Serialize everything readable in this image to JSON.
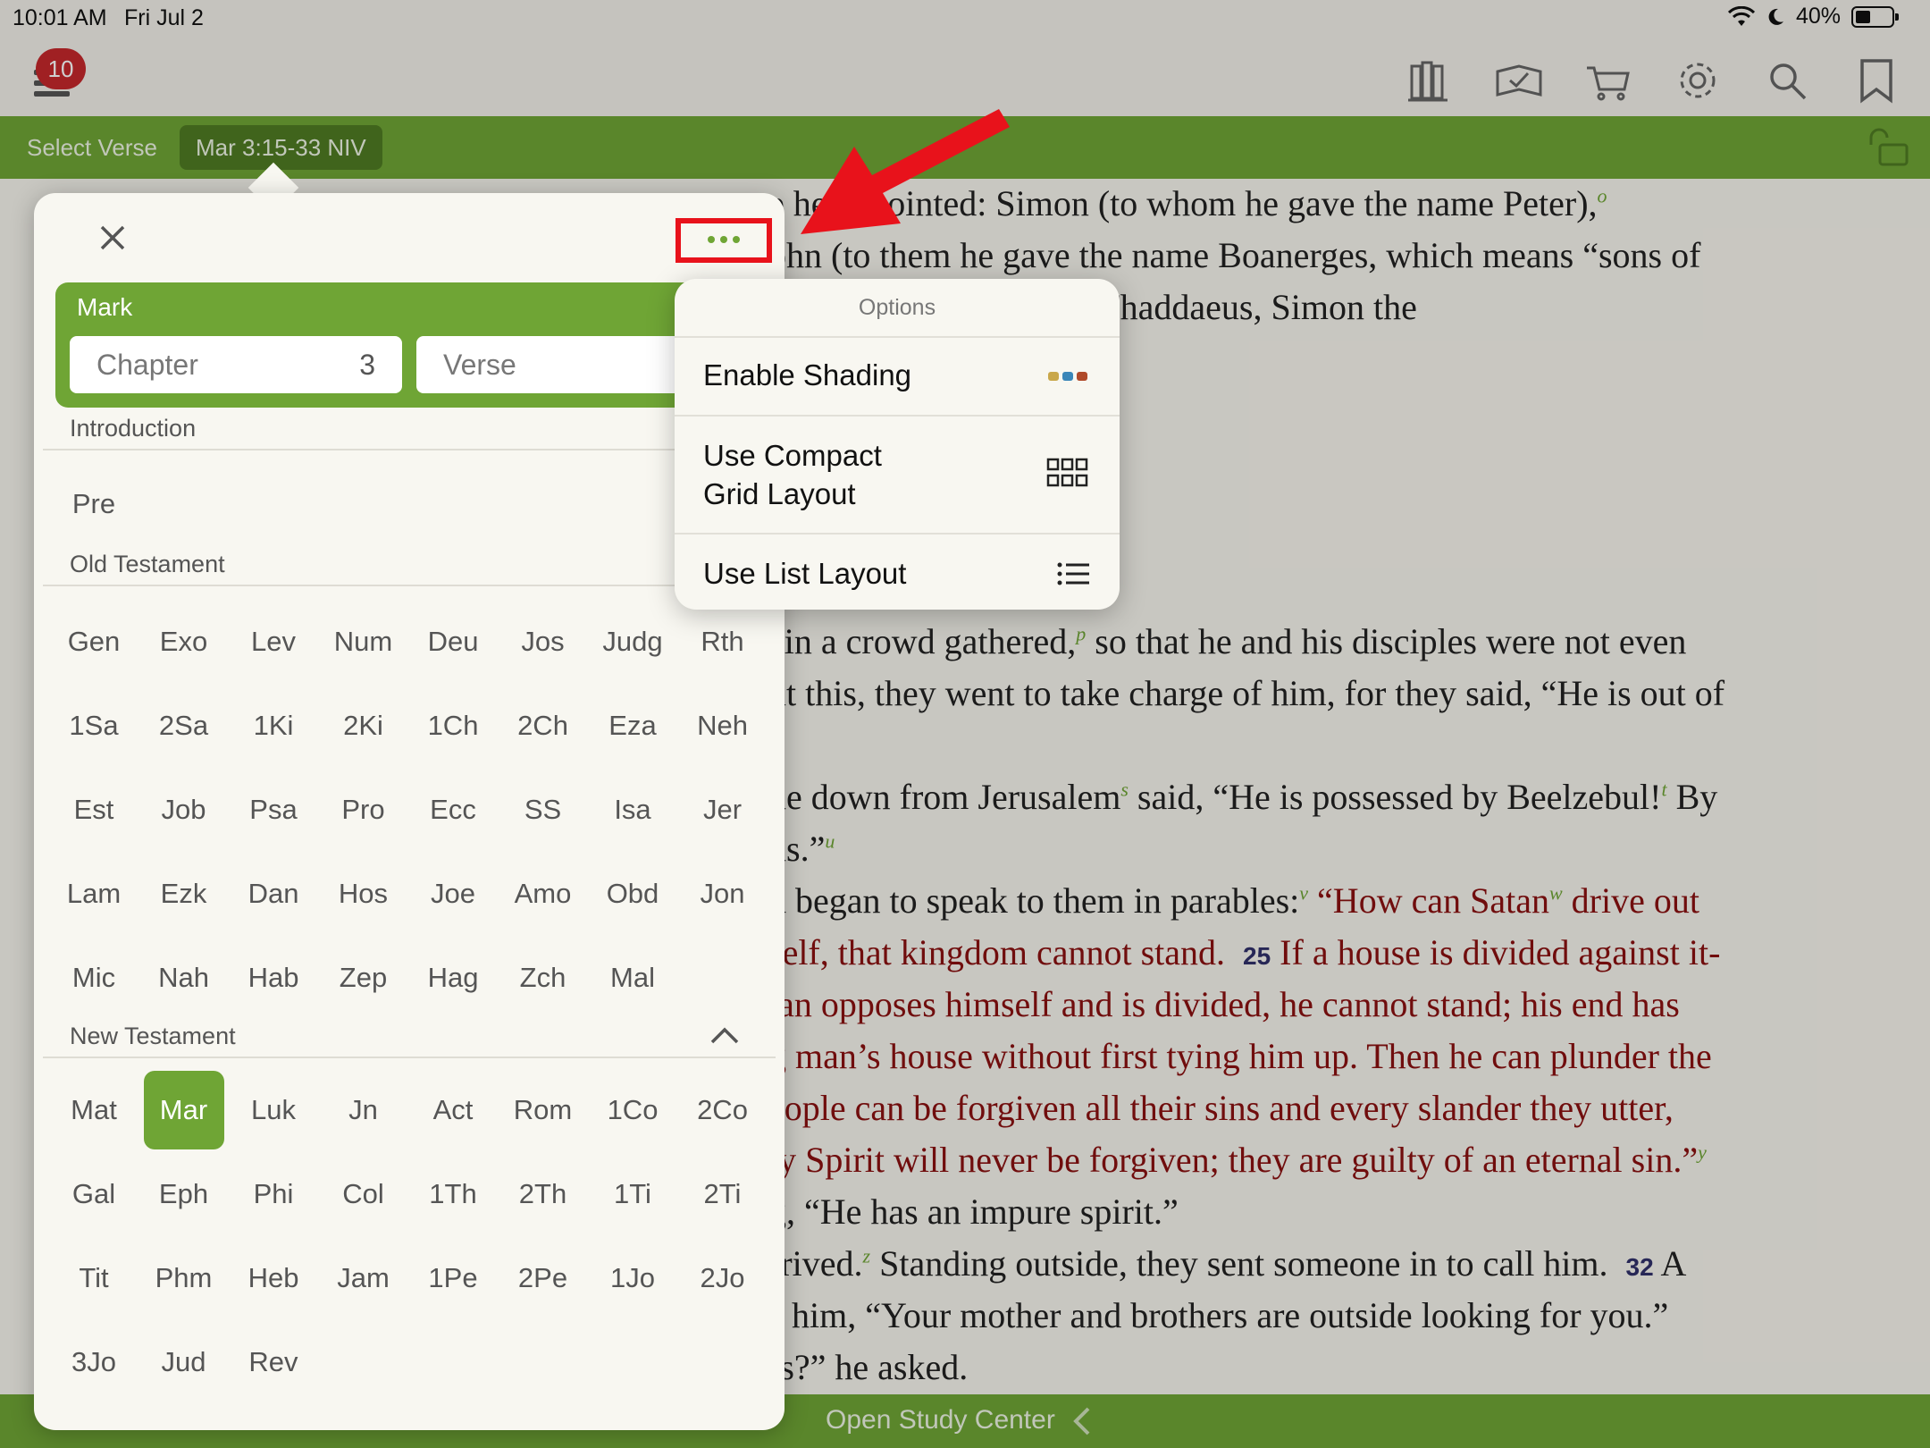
{
  "status": {
    "time": "10:01 AM",
    "date": "Fri Jul 2",
    "battery": "40%"
  },
  "toolbar": {
    "badge_count": "10"
  },
  "verse_bar": {
    "select_label": "Select Verse",
    "reference": "Mar 3:15-33 NIV"
  },
  "reading": {
    "lines": [
      {
        "text": "e he appointed: Simon (to whom he gave the name Peter),",
        "sup": "o",
        "red": false
      },
      {
        "text": "ohn (to them he gave the name Boanerges, which means “sons of",
        "sup": "",
        "red": false
      },
      {
        "text": "ames son of Alphaeus, Thaddaeus, Simon the",
        "sup": "",
        "red": false
      },
      {
        "text": "ain a crowd gathered,",
        "sup": "p",
        "tail": " so that he and his disciples were not even",
        "red": false
      },
      {
        "text": "ut this, they went to take charge of him, for they said, “He is out of",
        "sup": "",
        "red": false
      },
      {
        "text": "ne down from Jerusalem",
        "sup": "s",
        "tail": " said, “He is possessed by Beelzebul!",
        "sup2": "t",
        "tail2": " By",
        "red": false
      },
      {
        "text": "ns.”",
        "sup": "u",
        "red": false
      },
      {
        "text": "d began to speak to them in parables:",
        "sup": "v",
        "tail": " “How can Satan",
        "sup2": "w",
        "tail2": " drive out",
        "red": false
      },
      {
        "text": "self, that kingdom cannot stand.",
        "vnum": "25",
        "tail": " If a house is divided against it-",
        "red": true
      },
      {
        "text": "tan opposes himself and is divided, he cannot stand; his end has",
        "sup": "",
        "red": true
      },
      {
        "text": "g man’s house without first tying him up. Then he can plunder the",
        "sup": "",
        "red": true
      },
      {
        "text": "eople can be forgiven all their sins and every slander they utter,",
        "sup": "",
        "red": true
      },
      {
        "text": "ly Spirit will never be forgiven; they are guilty of an eternal sin.”",
        "sup": "y",
        "red": true
      },
      {
        "text": "g, “He has an impure spirit.”",
        "sup": "",
        "red": false
      },
      {
        "text": "rrived.",
        "sup": "z",
        "tail": " Standing outside, they sent someone in to call him.",
        "vnum2": "32",
        "tail2": " A",
        "red": false
      },
      {
        "text": "him, “Your mother and brothers are outside looking for you.”",
        "sup": "",
        "red": false
      },
      {
        "text": "rs?” he asked.",
        "sup": "",
        "red": false
      }
    ]
  },
  "bottom_bar": {
    "label": "Open Study Center"
  },
  "picker": {
    "book_name": "Mark",
    "chapter_label": "Chapter",
    "chapter_value": "3",
    "verse_label": "Verse",
    "sections": {
      "introduction": "Introduction",
      "old_testament": "Old Testament",
      "new_testament": "New Testament"
    },
    "intro_books": [
      "Pre"
    ],
    "ot_books": [
      "Gen",
      "Exo",
      "Lev",
      "Num",
      "Deu",
      "Jos",
      "Judg",
      "Rth",
      "1Sa",
      "2Sa",
      "1Ki",
      "2Ki",
      "1Ch",
      "2Ch",
      "Eza",
      "Neh",
      "Est",
      "Job",
      "Psa",
      "Pro",
      "Ecc",
      "SS",
      "Isa",
      "Jer",
      "Lam",
      "Ezk",
      "Dan",
      "Hos",
      "Joe",
      "Amo",
      "Obd",
      "Jon",
      "Mic",
      "Nah",
      "Hab",
      "Zep",
      "Hag",
      "Zch",
      "Mal"
    ],
    "nt_books": [
      "Mat",
      "Mar",
      "Luk",
      "Jn",
      "Act",
      "Rom",
      "1Co",
      "2Co",
      "Gal",
      "Eph",
      "Phi",
      "Col",
      "1Th",
      "2Th",
      "1Ti",
      "2Ti",
      "Tit",
      "Phm",
      "Heb",
      "Jam",
      "1Pe",
      "2Pe",
      "1Jo",
      "2Jo",
      "3Jo",
      "Jud",
      "Rev"
    ],
    "selected_book": "Mar"
  },
  "options": {
    "title": "Options",
    "items": [
      {
        "label_line1": "Enable Shading",
        "label_line2": "",
        "icon": "shading-icon"
      },
      {
        "label_line1": "Use Compact",
        "label_line2": "Grid Layout",
        "icon": "grid-icon"
      },
      {
        "label_line1": "Use List Layout",
        "label_line2": "",
        "icon": "list-icon"
      }
    ]
  },
  "colors": {
    "accent": "#6fa535",
    "badge": "#c5282c",
    "highlight": "#e8121b",
    "red_letter": "#8a1010"
  }
}
